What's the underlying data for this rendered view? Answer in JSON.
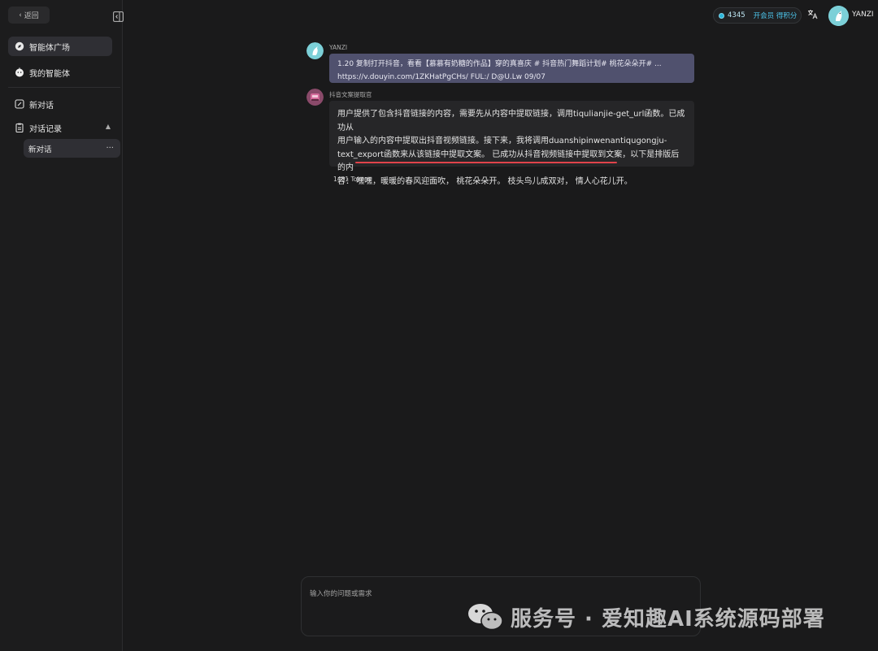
{
  "sidebar": {
    "back_label": "返回",
    "nav": [
      {
        "label": "智能体广场",
        "icon": "compass-icon"
      },
      {
        "label": "我的智能体",
        "icon": "bot-face-icon"
      },
      {
        "label": "新对话",
        "icon": "edit-icon"
      },
      {
        "label": "对话记录",
        "icon": "clipboard-icon"
      }
    ],
    "history": [
      {
        "label": "新对话",
        "more": "···"
      }
    ]
  },
  "header": {
    "points": "4345",
    "points_link": "开会员 得积分",
    "user_name": "YANZI"
  },
  "messages": [
    {
      "role": "user",
      "sender": "YANZI",
      "lines": [
        "1.20 复制打开抖音，看看【慕慕有奶糖的作品】穿的真喜庆 # 抖音热门舞蹈计划# 桃花朵朵开# ...",
        "https://v.douyin.com/1ZKHatPgCHs/ FUL:/ D@U.Lw 09/07"
      ]
    },
    {
      "role": "assistant",
      "sender": "抖音文案提取官",
      "lines": [
        "用户提供了包含抖音链接的内容，需要先从内容中提取链接，调用tiqulianjie-get_url函数。已成功从",
        "用户输入的内容中提取出抖音视频链接。接下来，我将调用duanshipinwenantiqugongju-",
        "text_export函数来从该链接中提取文案。 已成功从抖音视频链接中提取到文案，以下是排版后的内",
        "容： 嘿嘿，暖暖的春风迎面吹， 桃花朵朵开。 枝头鸟儿成双对， 情人心花儿开。"
      ],
      "tokens": "1461 Tokens"
    }
  ],
  "input": {
    "placeholder": "输入你的问题或需求"
  },
  "watermark": {
    "text": "服务号 · 爱知趣AI系统源码部署"
  },
  "colors": {
    "background": "#1a1a1b",
    "user_bubble": "#50516e",
    "bot_bubble": "#262628",
    "accent": "#4cc4ea",
    "highlight_underline": "#e0434a"
  }
}
